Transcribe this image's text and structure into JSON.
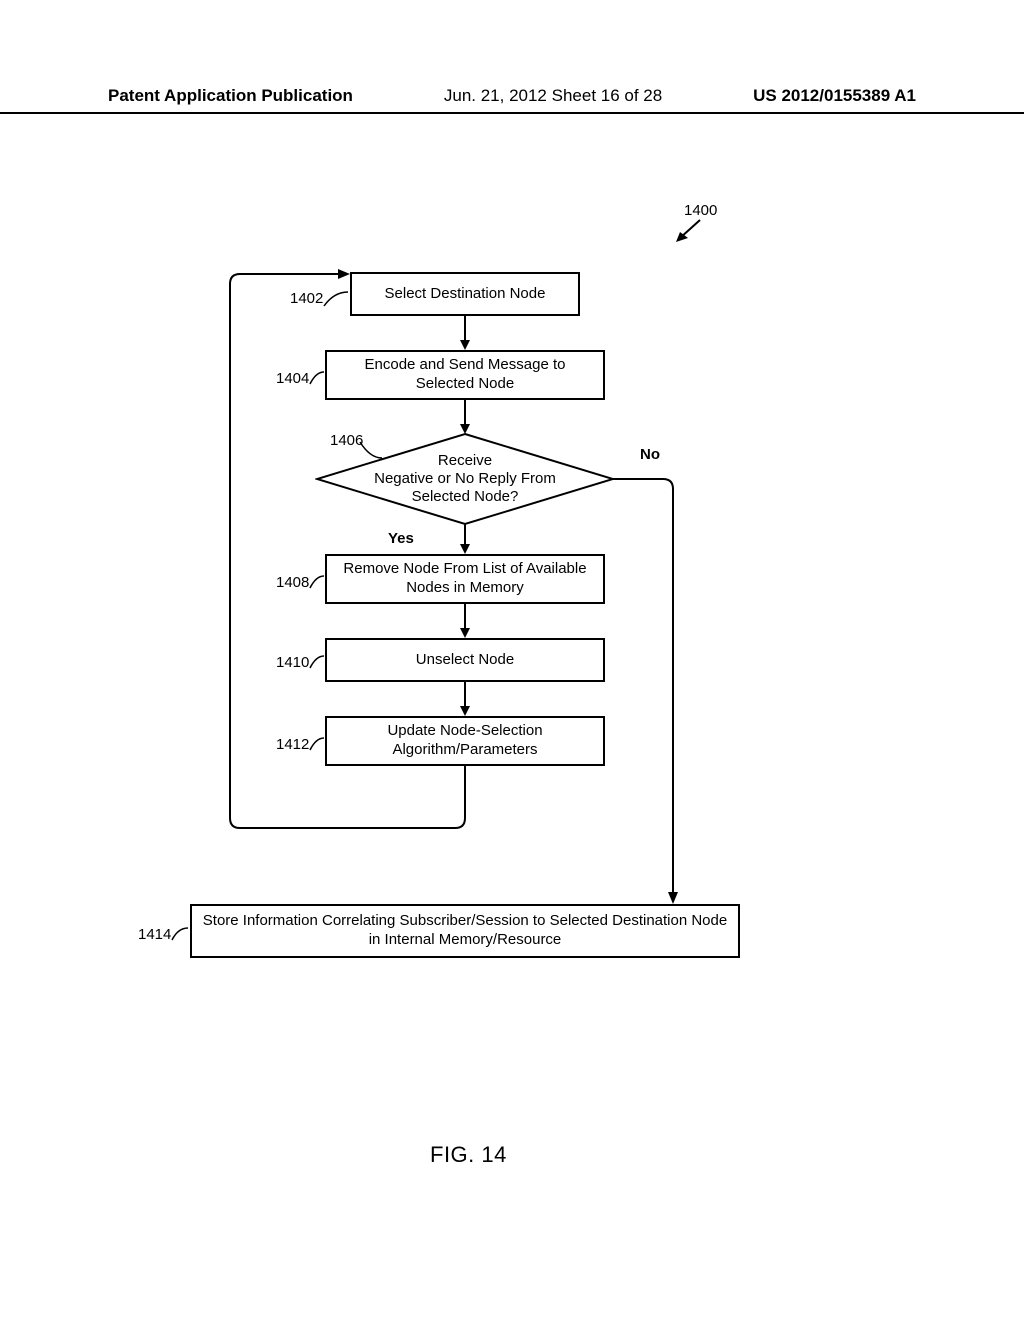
{
  "header": {
    "left": "Patent Application Publication",
    "mid": "Jun. 21, 2012  Sheet 16 of 28",
    "right": "US 2012/0155389 A1"
  },
  "diagram_ref": "1400",
  "steps": {
    "s1402": {
      "ref": "1402",
      "text": "Select Destination Node"
    },
    "s1404": {
      "ref": "1404",
      "text": "Encode and Send Message to Selected Node"
    },
    "s1406": {
      "ref": "1406",
      "text": "Receive\nNegative or No Reply From\nSelected Node?"
    },
    "s1408": {
      "ref": "1408",
      "text": "Remove Node From List of Available Nodes in Memory"
    },
    "s1410": {
      "ref": "1410",
      "text": "Unselect Node"
    },
    "s1412": {
      "ref": "1412",
      "text": "Update Node-Selection Algorithm/Parameters"
    },
    "s1414": {
      "ref": "1414",
      "text": "Store Information Correlating Subscriber/Session to Selected Destination Node in Internal Memory/Resource"
    }
  },
  "branch": {
    "yes": "Yes",
    "no": "No"
  },
  "figure_caption": "FIG. 14",
  "chart_data": {
    "type": "flowchart",
    "title": "FIG. 14",
    "diagram_reference": "1400",
    "nodes": [
      {
        "id": "1402",
        "type": "process",
        "label": "Select Destination Node"
      },
      {
        "id": "1404",
        "type": "process",
        "label": "Encode and Send Message to Selected Node"
      },
      {
        "id": "1406",
        "type": "decision",
        "label": "Receive Negative or No Reply From Selected Node?"
      },
      {
        "id": "1408",
        "type": "process",
        "label": "Remove Node From List of Available Nodes in Memory"
      },
      {
        "id": "1410",
        "type": "process",
        "label": "Unselect Node"
      },
      {
        "id": "1412",
        "type": "process",
        "label": "Update Node-Selection Algorithm/Parameters"
      },
      {
        "id": "1414",
        "type": "process",
        "label": "Store Information Correlating Subscriber/Session to Selected Destination Node in Internal Memory/Resource"
      }
    ],
    "edges": [
      {
        "from": "1402",
        "to": "1404"
      },
      {
        "from": "1404",
        "to": "1406"
      },
      {
        "from": "1406",
        "to": "1408",
        "label": "Yes"
      },
      {
        "from": "1406",
        "to": "1414",
        "label": "No"
      },
      {
        "from": "1408",
        "to": "1410"
      },
      {
        "from": "1410",
        "to": "1412"
      },
      {
        "from": "1412",
        "to": "1402",
        "label": "loop back"
      }
    ]
  }
}
